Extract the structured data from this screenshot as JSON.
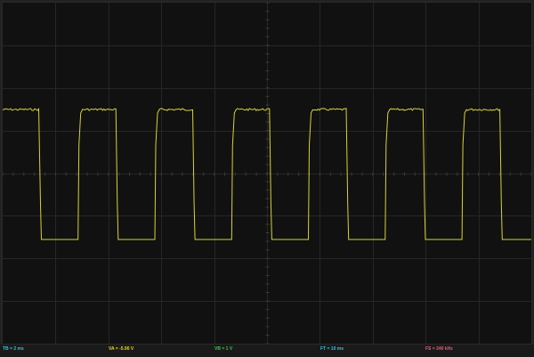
{
  "display": {
    "grid_color": "#262626",
    "center_axis_color": "#3a3a3a",
    "background": "#111111",
    "trace_color": "#d4d43a"
  },
  "waveform": {
    "type": "square",
    "period_ms": 2,
    "duty_cycle": 0.5,
    "cycles_shown": 7,
    "high_level": "high",
    "low_level": "low"
  },
  "status_bar": {
    "timebase": {
      "label": "TB = 2 ms",
      "color": "#2fc3d8"
    },
    "channel_a": {
      "label": "VA = -5.96 V",
      "color": "#e8d321"
    },
    "channel_b": {
      "label": "VB = 1 V",
      "color": "#39c93a"
    },
    "frame_time": {
      "label": "FT = 10 ms",
      "color": "#2fc3d8"
    },
    "sample_rate": {
      "label": "FS = 240 kHz",
      "color": "#e0607a"
    }
  }
}
